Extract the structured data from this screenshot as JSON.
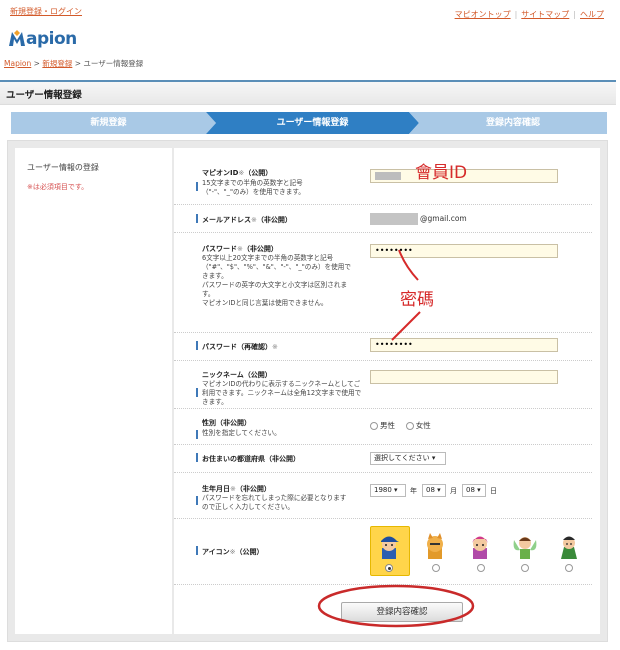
{
  "header": {
    "login_link": "新規登録・ログイン",
    "nav": [
      "マピオントップ",
      "サイトマップ",
      "ヘルプ"
    ],
    "logo_text": "apion"
  },
  "breadcrumb": {
    "items": [
      "Mapion",
      "新規登録"
    ],
    "current": "ユーザー情報登録",
    "sep": ">"
  },
  "page_title": "ユーザー情報登録",
  "steps": [
    "新規登録",
    "ユーザー情報登録",
    "登録内容確認"
  ],
  "sidebar": {
    "heading": "ユーザー情報の登録",
    "required_note": "※は必須項目です。"
  },
  "form": {
    "mapion_id": {
      "label": "マピオンID",
      "mark": "※",
      "scope": "（公開）",
      "desc": "15文字までの半角の英数字と記号\n（\"-\"、\"_\"のみ）を使用できます。"
    },
    "email": {
      "label": "メールアドレス",
      "mark": "※",
      "scope": "（非公開）",
      "domain": "@gmail.com"
    },
    "password": {
      "label": "パスワード",
      "mark": "※",
      "scope": "（非公開）",
      "desc": "6文字以上20文字までの半角の英数字と記号\n（\"#\"、\"$\"、\"%\"、\"&\"、\"-\"、\"_\"のみ）を使用できます。\nパスワードの英字の大文字と小文字は区別されます。\nマピオンIDと同じ言葉は使用できません。",
      "value": "••••••••"
    },
    "password_confirm": {
      "label": "パスワード（再確認）",
      "mark": "※",
      "value": "••••••••"
    },
    "nickname": {
      "label": "ニックネーム（公開）",
      "desc": "マピオンIDの代わりに表示するニックネームとしてご利用できます。ニックネームは全角12文字まで使用できます。"
    },
    "gender": {
      "label": "性別（非公開）",
      "desc": "性別を指定してください。",
      "options": [
        "男性",
        "女性"
      ]
    },
    "prefecture": {
      "label": "お住まいの都道府県（非公開）",
      "selected": "選択してください"
    },
    "birthday": {
      "label": "生年月日",
      "mark": "※",
      "scope": "（非公開）",
      "desc": "パスワードを忘れてしまった際に必要となりますので正しく入力してください。",
      "year": "1980",
      "month": "08",
      "day": "08",
      "year_unit": "年",
      "month_unit": "月",
      "day_unit": "日"
    },
    "icon": {
      "label": "アイコン",
      "mark": "※",
      "scope": "（公開）",
      "selected_index": 0
    },
    "submit_label": "登録内容確認"
  },
  "annotations": {
    "member_id": "會員ID",
    "password": "密碼"
  },
  "colors": {
    "accent_blue": "#3f79b8",
    "link_orange": "#d35a2a",
    "required_red": "#d64f4f",
    "annotation_red": "#d62a2a"
  }
}
